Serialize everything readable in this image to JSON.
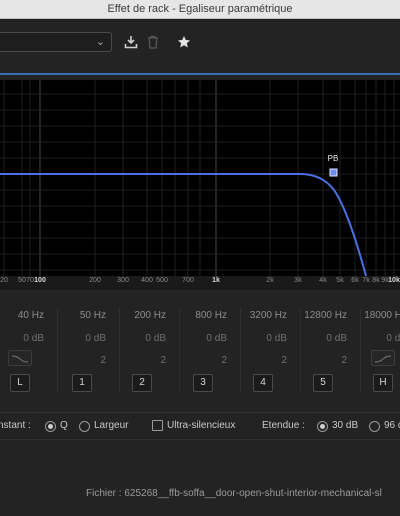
{
  "window": {
    "title": "Effet de rack - Egaliseur paramétrique"
  },
  "toolbar": {
    "preset_value": "",
    "save_icon": "download-save-icon",
    "delete_icon": "trash-icon",
    "favorite_icon": "star-icon"
  },
  "graph": {
    "handle_label": "PB",
    "curve_color": "#4a6fe0",
    "handle_color": "#6e8cf2"
  },
  "freq_axis": {
    "labels": [
      "20",
      "50",
      "70",
      "100",
      "200",
      "300",
      "400",
      "500",
      "700",
      "1k",
      "2k",
      "3k",
      "4k",
      "5k",
      "6k",
      "7k",
      "8k",
      "9k",
      "10k"
    ]
  },
  "bands": [
    {
      "hz": "40 Hz",
      "db": "0 dB",
      "q": "",
      "button": "L",
      "shape_icon": "low-shelf-icon"
    },
    {
      "hz": "50 Hz",
      "db": "0 dB",
      "q": "2",
      "button": "1"
    },
    {
      "hz": "200 Hz",
      "db": "0 dB",
      "q": "2",
      "button": "2"
    },
    {
      "hz": "800 Hz",
      "db": "0 dB",
      "q": "2",
      "button": "3"
    },
    {
      "hz": "3200 Hz",
      "db": "0 dB",
      "q": "2",
      "button": "4"
    },
    {
      "hz": "12800 Hz",
      "db": "0 dB",
      "q": "2",
      "button": "5"
    },
    {
      "hz": "18000 Hz",
      "db": "0 dB",
      "q": "",
      "button": "H",
      "shape_icon": "high-shelf-icon"
    }
  ],
  "options": {
    "constant_label": "nstant :",
    "q_label": "Q",
    "width_label": "Largeur",
    "ultra_label": "Ultra-silencieux",
    "range_label": "Etendue :",
    "range_30": "30 dB",
    "range_96": "96 d"
  },
  "status": {
    "file": "Fichier : 625268__ffb-soffa__door-open-shut-interior-mechanical-sl"
  }
}
